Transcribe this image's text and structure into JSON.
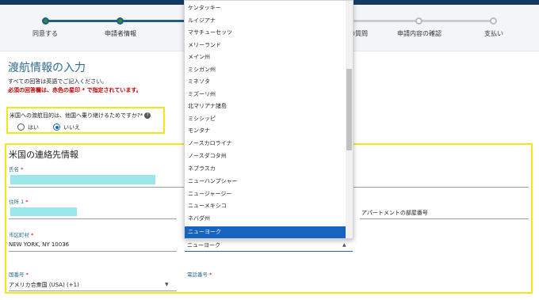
{
  "steps": [
    {
      "label": "同意する",
      "state": "done"
    },
    {
      "label": "申請者情報",
      "state": "done"
    },
    {
      "label": "",
      "state": "done"
    },
    {
      "label": "",
      "state": "todo"
    },
    {
      "label": "適格性の質問",
      "state": "todo"
    },
    {
      "label": "申請内容の確認",
      "state": "todo"
    },
    {
      "label": "支払い",
      "state": "todo"
    }
  ],
  "page": {
    "title": "渡航情報の入力",
    "note_english": "すべての回答は英語でご記入ください。",
    "note_required": "必須の回答欄は、赤色の星印 * で指定されています。"
  },
  "transit": {
    "question": "米国への渡航目的は、他国へ乗り継けるためですか?*",
    "options": [
      "はい",
      "いいえ"
    ],
    "selected": "いいえ"
  },
  "contact": {
    "section_title": "米国の連絡先情報",
    "name_label": "氏名",
    "address1_label": "住所 1",
    "apartment_label": "アパートメントの部屋番号",
    "city_label": "市区町村",
    "city_value": "NEW YORK, NY 10036",
    "state_value": "ニューヨーク",
    "country_code_label": "国番号",
    "country_code_value": "アメリカ合衆国 (USA) (+1)",
    "phone_label": "電話番号",
    "required_mark": "*"
  },
  "state_dropdown": {
    "options": [
      "ケンタッキー",
      "ルイジアナ",
      "マサチューセッツ",
      "メリーランド",
      "メイン州",
      "ミシガン州",
      "ミネソタ",
      "ミズーリ州",
      "北マリアナ諸島",
      "ミシシッピ",
      "モンタナ",
      "ノースカロライナ",
      "ノースダコタ州",
      "ネブラスカ",
      "ニューハンプシャー",
      "ニュージャージー",
      "ニューメキシコ",
      "ネバダ州",
      "ニューヨーク"
    ],
    "selected": "ニューヨーク"
  },
  "colors": {
    "accent_blue": "#1565c0",
    "header_navy": "#173a63",
    "step_done": "#2e8b2e",
    "highlight_yellow": "#f1e81c",
    "required_red": "#c00000",
    "redacted_cyan": "#9be8ea"
  }
}
